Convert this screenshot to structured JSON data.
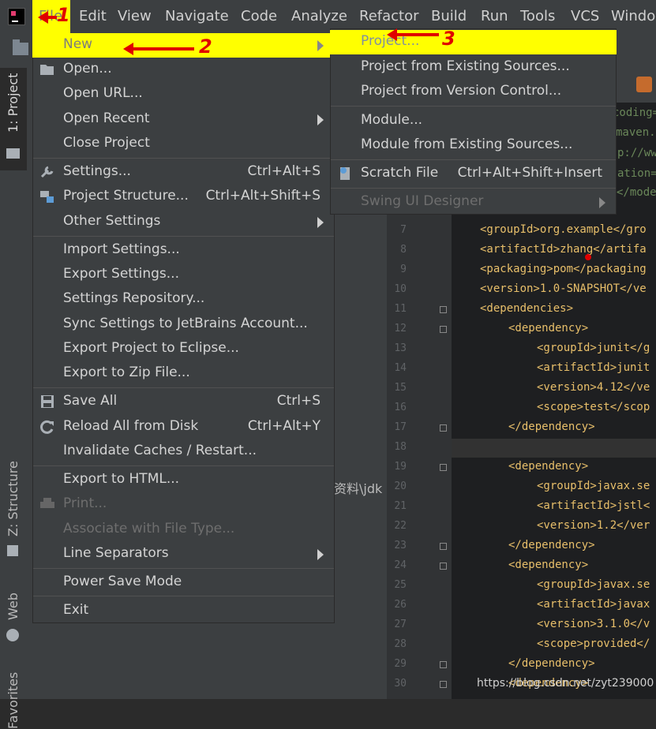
{
  "menubar": {
    "items": [
      "File",
      "Edit",
      "View",
      "Navigate",
      "Code",
      "Analyze",
      "Refactor",
      "Build",
      "Run",
      "Tools",
      "VCS",
      "Window"
    ]
  },
  "sidebar": {
    "tabs": [
      "1: Project",
      "Z: Structure",
      "Web",
      "Favorites"
    ]
  },
  "file_menu": {
    "items": [
      {
        "label": "New",
        "has_submenu": true,
        "highlighted": true
      },
      {
        "label": "Open..."
      },
      {
        "label": "Open URL..."
      },
      {
        "label": "Open Recent",
        "has_submenu": true
      },
      {
        "label": "Close Project"
      },
      {
        "label": "Settings...",
        "shortcut": "Ctrl+Alt+S"
      },
      {
        "label": "Project Structure...",
        "shortcut": "Ctrl+Alt+Shift+S"
      },
      {
        "label": "Other Settings",
        "has_submenu": true
      },
      {
        "label": "Import Settings..."
      },
      {
        "label": "Export Settings..."
      },
      {
        "label": "Settings Repository..."
      },
      {
        "label": "Sync Settings to JetBrains Account..."
      },
      {
        "label": "Export Project to Eclipse..."
      },
      {
        "label": "Export to Zip File..."
      },
      {
        "label": "Save All",
        "shortcut": "Ctrl+S"
      },
      {
        "label": "Reload All from Disk",
        "shortcut": "Ctrl+Alt+Y"
      },
      {
        "label": "Invalidate Caches / Restart..."
      },
      {
        "label": "Export to HTML..."
      },
      {
        "label": "Print...",
        "disabled": true
      },
      {
        "label": "Associate with File Type...",
        "disabled": true
      },
      {
        "label": "Line Separators",
        "has_submenu": true
      },
      {
        "label": "Power Save Mode"
      },
      {
        "label": "Exit"
      }
    ]
  },
  "new_submenu": {
    "items": [
      {
        "label": "Project...",
        "highlighted": true
      },
      {
        "label": "Project from Existing Sources..."
      },
      {
        "label": "Project from Version Control..."
      },
      {
        "label": "Module..."
      },
      {
        "label": "Module from Existing Sources..."
      },
      {
        "label": "Scratch File",
        "shortcut": "Ctrl+Alt+Shift+Insert"
      },
      {
        "label": "Swing UI Designer",
        "has_submenu": true,
        "disabled": true
      }
    ]
  },
  "annotations": [
    "1",
    "2",
    "3"
  ],
  "project_panel": {
    "path_fragment": "资料\\jdk"
  },
  "editor": {
    "partial_header_lines": [
      "coding=",
      "maven.",
      "p://ww",
      "ation=\"",
      "</mode"
    ],
    "line_numbers": [
      "7",
      "8",
      "9",
      "10",
      "11",
      "12",
      "13",
      "14",
      "15",
      "16",
      "17",
      "18",
      "19",
      "20",
      "21",
      "22",
      "23",
      "24",
      "25",
      "26",
      "27",
      "28",
      "29",
      "30"
    ],
    "lines": [
      "<groupId>org.example</gro",
      "<artifactId>zhang</artifa",
      "<packaging>pom</packaging",
      "<version>1.0-SNAPSHOT</ve",
      "<dependencies>",
      "<dependency>",
      "<groupId>junit</g",
      "<artifactId>junit",
      "<version>4.12</ve",
      "<scope>test</scop",
      "</dependency>",
      "",
      "<dependency>",
      "<groupId>javax.se",
      "<artifactId>jstl<",
      "<version>1.2</ver",
      "</dependency>",
      "<dependency>",
      "<groupId>javax.se",
      "<artifactId>javax",
      "<version>3.1.0</v",
      "<scope>provided</",
      "</dependency>",
      "<dependency>"
    ]
  },
  "watermark": "https://blog.csdn.net/zyt239000"
}
